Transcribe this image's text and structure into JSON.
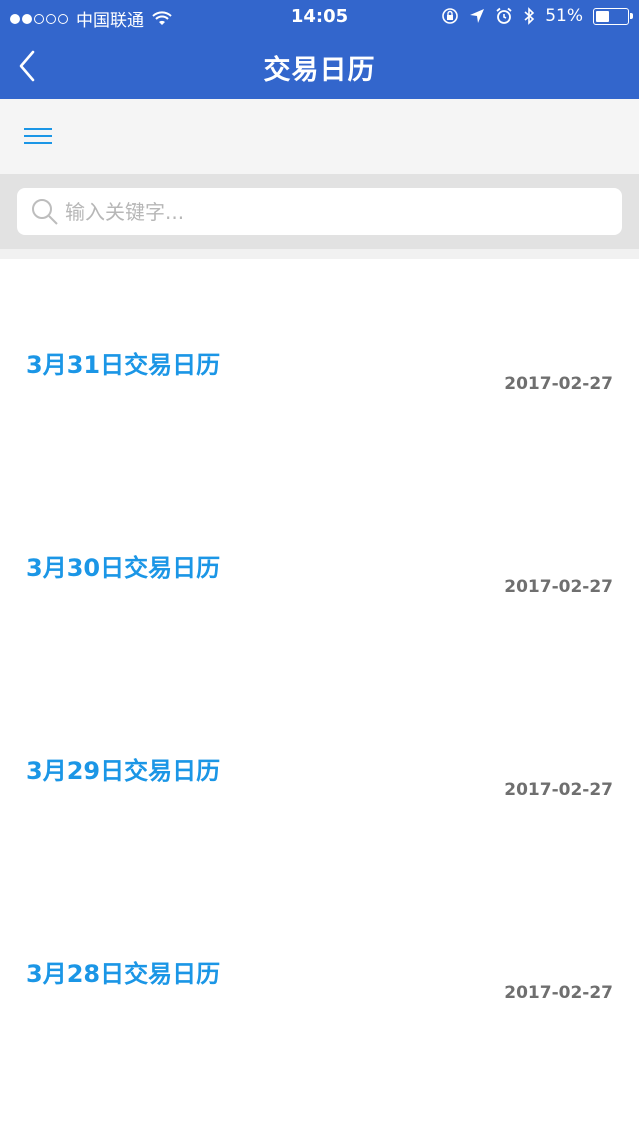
{
  "status_bar": {
    "carrier": "中国联通",
    "time": "14:05",
    "battery": "51%",
    "battery_level": 0.51,
    "signal_bars_filled": 2,
    "signal_bars_total": 5,
    "icons": [
      "wifi-icon",
      "lock-rotation-icon",
      "location-icon",
      "alarm-icon",
      "bluetooth-icon",
      "battery-icon"
    ]
  },
  "nav": {
    "title": "交易日历",
    "back_icon": "chevron-left-icon"
  },
  "toolbar": {
    "menu_icon": "hamburger-menu-icon"
  },
  "search": {
    "placeholder": "输入关键字...",
    "value": "",
    "icon": "search-icon"
  },
  "list": {
    "items": [
      {
        "title": "3月31日交易日历",
        "date": "2017-02-27"
      },
      {
        "title": "3月30日交易日历",
        "date": "2017-02-27"
      },
      {
        "title": "3月29日交易日历",
        "date": "2017-02-27"
      },
      {
        "title": "3月28日交易日历",
        "date": "2017-02-27"
      }
    ]
  },
  "colors": {
    "header": "#3366cc",
    "title_link": "#1b96e6",
    "date_text": "#6f6f6f",
    "toolbar_bg": "#f5f5f5",
    "search_bg": "#e2e2e2"
  }
}
